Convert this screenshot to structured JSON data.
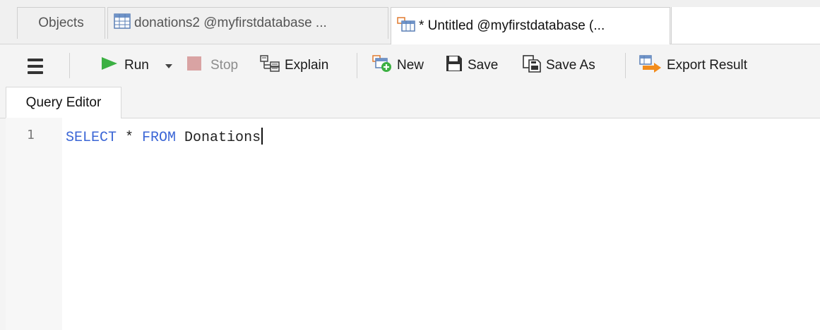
{
  "tabs": [
    {
      "label": "Objects"
    },
    {
      "label": "donations2 @myfirstdatabase ..."
    },
    {
      "label": "* Untitled @myfirstdatabase (..."
    }
  ],
  "toolbar": {
    "run_label": "Run",
    "stop_label": "Stop",
    "explain_label": "Explain",
    "new_label": "New",
    "save_label": "Save",
    "save_as_label": "Save As",
    "export_label": "Export Result"
  },
  "editor": {
    "tab_label": "Query Editor",
    "line_number": "1",
    "code": {
      "kw1": "SELECT",
      "star": " * ",
      "kw2": "FROM",
      "rest": " Donations"
    }
  },
  "colors": {
    "keyword": "#3b66d6",
    "run_icon": "#3cb043",
    "stop_icon": "#d9a3a3",
    "export_icon": "#f28c1c"
  }
}
